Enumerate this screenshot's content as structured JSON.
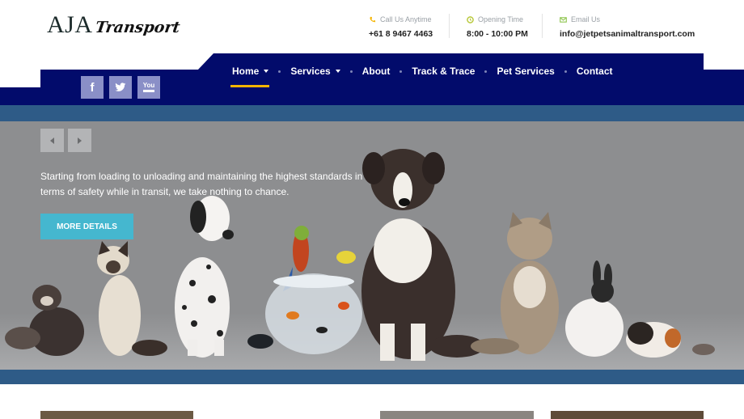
{
  "brand": {
    "logo_main": "AJA",
    "logo_script": "Transport"
  },
  "contact": [
    {
      "label": "Call Us Anytime",
      "value": "+61 8 9467 4463",
      "icon": "phone-icon",
      "icon_color": "#f5b400"
    },
    {
      "label": "Opening Time",
      "value": "8:00 - 10:00 PM",
      "icon": "clock-icon",
      "icon_color": "#b8c83a"
    },
    {
      "label": "Email Us",
      "value": "info@jetpetsanimaltransport.com",
      "icon": "envelope-icon",
      "icon_color": "#8bc34a"
    }
  ],
  "nav": {
    "items": [
      {
        "label": "Home",
        "dropdown": true,
        "active": true
      },
      {
        "label": "Services",
        "dropdown": true
      },
      {
        "label": "About"
      },
      {
        "label": "Track & Trace"
      },
      {
        "label": "Pet Services"
      },
      {
        "label": "Contact"
      }
    ],
    "accent": "#f5b400",
    "background": "#020b6b"
  },
  "social": [
    {
      "name": "facebook-icon",
      "glyph": "f"
    },
    {
      "name": "twitter-icon",
      "glyph": "🐦"
    },
    {
      "name": "youtube-icon",
      "glyph": "You"
    }
  ],
  "hero": {
    "text": "Starting from loading to unloading and maintaining the highest standards in terms of safety while in transit, we take nothing to chance.",
    "cta_label": "MORE DETAILS",
    "cta_color": "#45b7cf"
  }
}
